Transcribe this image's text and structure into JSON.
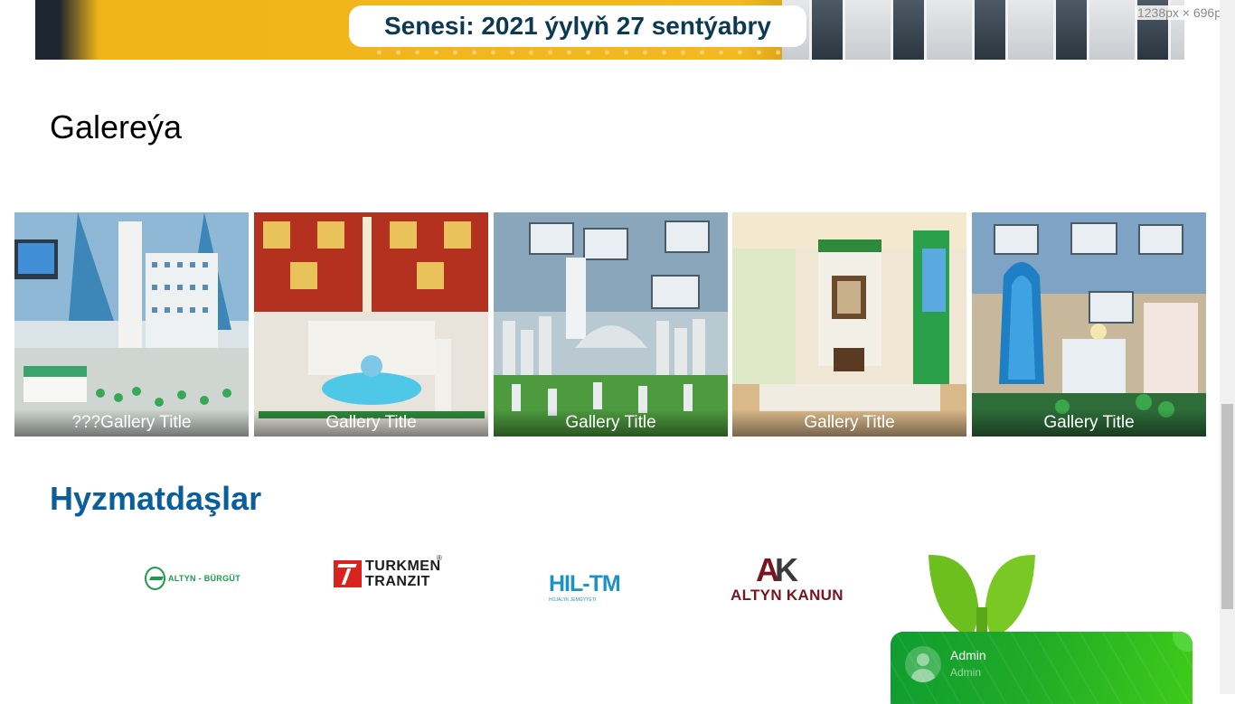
{
  "banner": {
    "date_text": "Senesi: 2021 ýylyň 27 sentýabry"
  },
  "viewport_readout": "1238px × 696px",
  "gallery": {
    "heading": "Galereýa",
    "items": [
      {
        "title": "???Gallery Title"
      },
      {
        "title": "Gallery Title"
      },
      {
        "title": "Gallery Title"
      },
      {
        "title": "Gallery Title"
      },
      {
        "title": "Gallery Title"
      }
    ]
  },
  "partners": {
    "heading": "Hyzmatdaşlar",
    "logos": {
      "burgut": "ALTYN - BÜRGÜT",
      "tranzit_line1": "TURKMEN",
      "tranzit_line2": "TRANZIT",
      "tranzit_reg": "®",
      "hil": "HIL-TM",
      "hil_sub": "HOJALYK JEMGYÝETI",
      "kanun_a": "A",
      "kanun_k": "K",
      "kanun_word": "ALTYN KANUN"
    }
  },
  "chat": {
    "name": "Admin",
    "role": "Admin"
  },
  "colors": {
    "partners_heading": "#0b5e9c",
    "chat_green": "#1faa27",
    "banner_yellow": "#f3b922"
  }
}
